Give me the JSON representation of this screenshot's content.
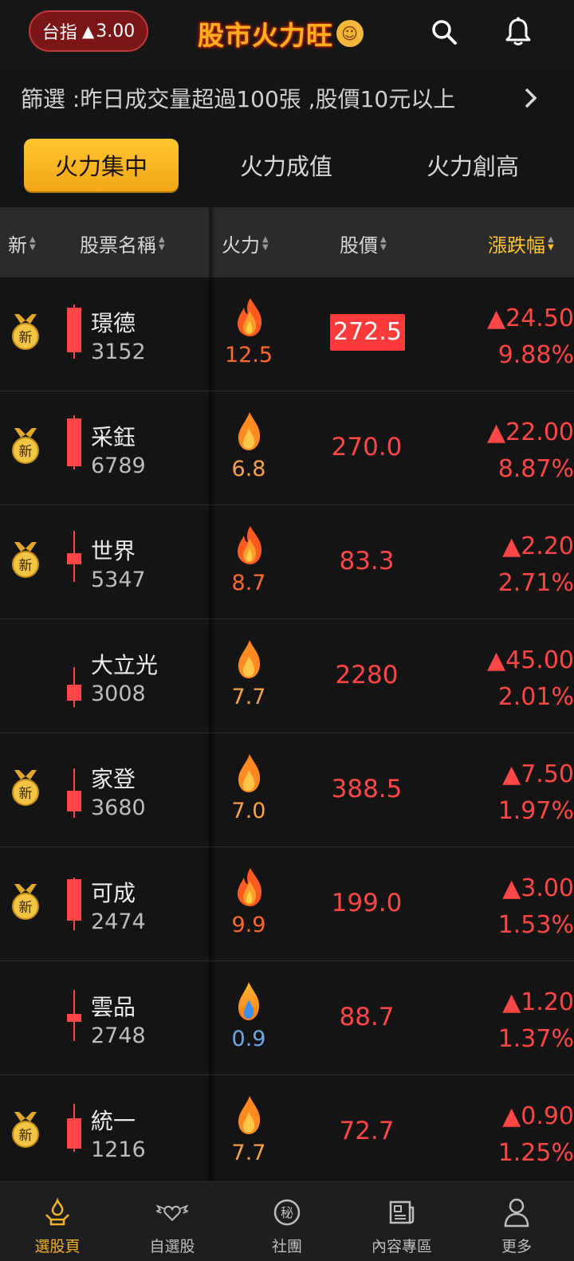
{
  "header": {
    "index_label": "台指",
    "index_arrow": "▲",
    "index_value": "3.00",
    "brand": "股市火力旺",
    "icons": [
      "search-icon",
      "bell-icon"
    ]
  },
  "filter": {
    "text": "篩選 :昨日成交量超過100張 ,股價10元以上"
  },
  "tabs": [
    {
      "label": "火力集中",
      "active": true
    },
    {
      "label": "火力成值",
      "active": false
    },
    {
      "label": "火力創高",
      "active": false
    }
  ],
  "columns": {
    "new": "新",
    "name": "股票名稱",
    "fire": "火力",
    "price": "股價",
    "change": "漲跌幅"
  },
  "rows": [
    {
      "name": "璟德",
      "code": "3152",
      "fire": "12.5",
      "price": "272.5",
      "change": "▲24.50",
      "pct": "9.88%",
      "new": true
    },
    {
      "name": "采鈺",
      "code": "6789",
      "fire": "6.8",
      "price": "270.0",
      "change": "▲22.00",
      "pct": "8.87%",
      "new": true
    },
    {
      "name": "世界",
      "code": "5347",
      "fire": "8.7",
      "price": "83.3",
      "change": "▲2.20",
      "pct": "2.71%",
      "new": true
    },
    {
      "name": "大立光",
      "code": "3008",
      "fire": "7.7",
      "price": "2280",
      "change": "▲45.00",
      "pct": "2.01%",
      "new": false
    },
    {
      "name": "家登",
      "code": "3680",
      "fire": "7.0",
      "price": "388.5",
      "change": "▲7.50",
      "pct": "1.97%",
      "new": true
    },
    {
      "name": "可成",
      "code": "2474",
      "fire": "9.9",
      "price": "199.0",
      "change": "▲3.00",
      "pct": "1.53%",
      "new": true
    },
    {
      "name": "雲品",
      "code": "2748",
      "fire": "0.9",
      "price": "88.7",
      "change": "▲1.20",
      "pct": "1.37%",
      "new": false
    },
    {
      "name": "統一",
      "code": "1216",
      "fire": "7.7",
      "price": "72.7",
      "change": "▲0.90",
      "pct": "1.25%",
      "new": true
    }
  ],
  "badge_text": "新",
  "colors": {
    "accent": "#f3b22a",
    "up": "#ff4747",
    "fire_hot": "#ff6a2a",
    "fire_warm": "#f6a24a",
    "fire_cold": "#6ea8e8"
  },
  "nav": [
    {
      "label": "選股頁",
      "icon": "stock-pick-icon",
      "active": true
    },
    {
      "label": "自選股",
      "icon": "winged-heart-icon",
      "active": false
    },
    {
      "label": "社團",
      "icon": "secret-club-icon",
      "active": false
    },
    {
      "label": "內容專區",
      "icon": "news-icon",
      "active": false
    },
    {
      "label": "更多",
      "icon": "user-icon",
      "active": false
    }
  ]
}
